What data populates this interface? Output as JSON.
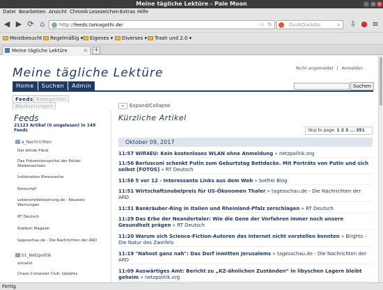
{
  "window": {
    "title": "Meine tägliche Lektüre - Pale Moon"
  },
  "menu": [
    "Datei",
    "Bearbeiten",
    "Ansicht",
    "Chronik",
    "Lesezeichen",
    "Extras",
    "Hilfe"
  ],
  "navbar": {
    "url_prefix": "http://",
    "url_domain": "feeds.tamagothi.de",
    "url_suffix": "/",
    "search_placeholder": "DuckDuckGo"
  },
  "bookmarks": [
    "Meistbesucht ▾",
    "Regelmäßig ▾",
    "Eigenes ▾",
    "Diverses ▾",
    "Trash und 2.0 ▾"
  ],
  "tab": {
    "label": "Meine tägliche Lektüre"
  },
  "site": {
    "title": "Meine tägliche Lektüre",
    "login": "Nicht angemeldet",
    "login_sep": "|",
    "login_link": "Anmelden",
    "nav": [
      "Home",
      "Suchen",
      "Admin"
    ],
    "search_button": "Suchen"
  },
  "sidebar": {
    "tabs": [
      "Feeds",
      "Kategorien",
      "Markierungen"
    ],
    "title": "Feeds",
    "count": "21123 Artikel (0 ungelesen) in 148 Feeds",
    "categories": [
      {
        "name": "a_Nachrichten",
        "feeds": [
          "Der blinde Fleck",
          "Das Präventionsportal der Polizei Niedersachsen",
          "Indiskretion Ehrensache",
          "Konsumpf",
          "Lebensmittelwarnung.de - Neueste Warnungen",
          "RT Deutsch",
          "Rubikon Magazin",
          "tagesschau.de - Die Nachrichten der ARD"
        ]
      },
      {
        "name": "b1_Netzpolitik",
        "feeds": [
          "annalist",
          "Chaos Computer Club: Updates"
        ]
      }
    ]
  },
  "main": {
    "expand": "Expand/Collapse",
    "expand_btn": "«",
    "title": "Kürzliche Artikel",
    "pager_label": "Skip to page:",
    "pager_pages": "1 2 3 ... 351",
    "date": "Oktober 09, 2017",
    "articles": [
      {
        "time": "11:57",
        "title": "Wifi4EU: Kein kostenloses WLAN ohne Anmeldung",
        "source": "netzpolitik.org"
      },
      {
        "time": "11:56",
        "title": "Berlusconi schenkt Putin zum Geburtstag Bettdecke. Mit Porträts von Putin und sich selbst [FOTOS]",
        "source": "RT Deutsch"
      },
      {
        "time": "11:56",
        "title": "5 vor 12 - Interessante Links aus dem Web",
        "source": "botfrei Blog"
      },
      {
        "time": "11:51",
        "title": "Wirtschaftsnobelpreis für US-Ökonomen Thaler",
        "source": "tagesschau.de - Die Nachrichten der ARD"
      },
      {
        "time": "11:31",
        "title": "Bankräuber-Ring in Italien und Rheinland-Pfalz zerschlagen",
        "source": "RT Deutsch"
      },
      {
        "time": "11:29",
        "title": "Das Erbe der Neandertaler: Wie die Gene der Vorfahren immer noch unsere Gesundheit prägen",
        "source": "RT Deutsch"
      },
      {
        "time": "11:20",
        "title": "Warum sich Science-Fiction-Autoren das Internet nicht vorstellen konnten",
        "source": "Brights - Die Natur des Zweifels"
      },
      {
        "time": "11:19",
        "title": "\"Nahost ganz nah\": Das Dorf inmitten Jerusalems",
        "source": "tagesschau.de - Die Nachrichten der ARD"
      },
      {
        "time": "11:09",
        "title": "Auswärtiges Amt: Bericht zu „KZ-ähnlichen Zuständen“ in libyschen Lagern bleibt geheim",
        "source": "netzpolitik.org"
      }
    ]
  },
  "status": {
    "text": "Fertig"
  }
}
